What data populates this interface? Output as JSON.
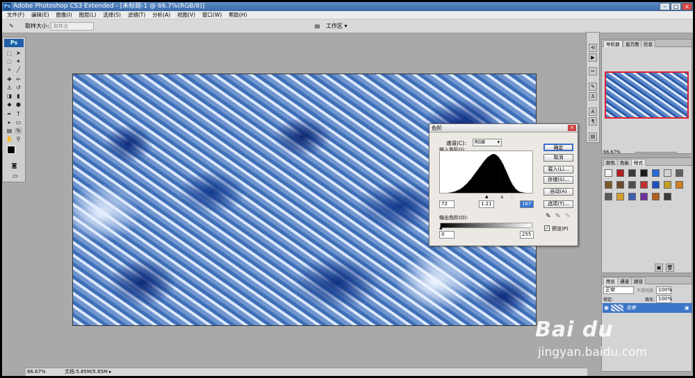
{
  "window": {
    "title": "Adobe Photoshop CS3 Extended - [未标题-1 @ 66.7%(RGB/8)]",
    "app_icon": "Ps"
  },
  "menu": [
    "文件(F)",
    "编辑(E)",
    "图像(I)",
    "图层(L)",
    "选择(S)",
    "滤镜(T)",
    "分析(A)",
    "视图(V)",
    "窗口(W)",
    "帮助(H)"
  ],
  "options": {
    "sample_label": "取样大小:",
    "sample_value": "取样点",
    "workspace": "工作区 ▾"
  },
  "toolbox": {
    "logo": "Ps"
  },
  "status": {
    "zoom": "66.67%",
    "doc": "文档:5.85M/5.85M"
  },
  "levels": {
    "title": "色阶",
    "channel_label": "通道(C):",
    "channel_value": "RGB",
    "input_label": "输入色阶(I):",
    "in_black": "72",
    "in_gamma": "1.21",
    "in_white": "167",
    "output_label": "输出色阶(O):",
    "out_black": "0",
    "out_white": "255",
    "buttons": [
      "确定",
      "取消",
      "载入(L)...",
      "存储(S)...",
      "自动(A)",
      "选项(T)..."
    ],
    "preview_label": "预览(P)",
    "histogram": [
      0,
      0,
      0,
      0,
      1,
      1,
      1,
      2,
      2,
      3,
      3,
      4,
      5,
      6,
      7,
      8,
      9,
      10,
      12,
      13,
      15,
      17,
      19,
      21,
      23,
      25,
      28,
      30,
      33,
      35,
      38,
      41,
      44,
      47,
      50,
      53,
      56,
      59,
      62,
      65,
      68,
      71,
      74,
      77,
      80,
      83,
      85,
      88,
      90,
      92,
      94,
      95,
      97,
      98,
      99,
      100,
      100,
      99,
      98,
      97,
      95,
      93,
      90,
      87,
      84,
      80,
      76,
      72,
      67,
      62,
      57,
      52,
      47,
      42,
      37,
      32,
      28,
      24,
      20,
      17,
      14,
      11,
      9,
      7,
      5,
      4,
      3,
      2,
      2,
      1,
      1,
      1,
      0,
      0,
      0
    ]
  },
  "nav_panel": {
    "tabs": [
      "导航器",
      "直方图",
      "信息"
    ],
    "zoom": "66.67%"
  },
  "styles_panel": {
    "tabs": [
      "颜色",
      "色板",
      "样式"
    ],
    "swatches": [
      "#f2f2f2",
      "#b02020",
      "#3a3a3a",
      "#1a1a1a",
      "#2a6ad0",
      "#d0d0d0",
      "#606060",
      "#7b5a2a",
      "#6a4a2a",
      "#505050",
      "#c03030",
      "#2050c0",
      "#c0a020",
      "#d08020",
      "#5a5a5a",
      "#d6a030",
      "#4060b0",
      "#7030a0",
      "#b06020",
      "#3a3a3a"
    ]
  },
  "layers_panel": {
    "tabs": [
      "图层",
      "通道",
      "路径"
    ],
    "blend": "正常",
    "opacity_label": "不透明度:",
    "opacity": "100%",
    "lock_label": "锁定:",
    "fill_label": "填充:",
    "fill": "100%",
    "layer_name": "背景"
  },
  "watermark": {
    "logo": "Bai du",
    "url": "jingyan.baidu.com"
  }
}
